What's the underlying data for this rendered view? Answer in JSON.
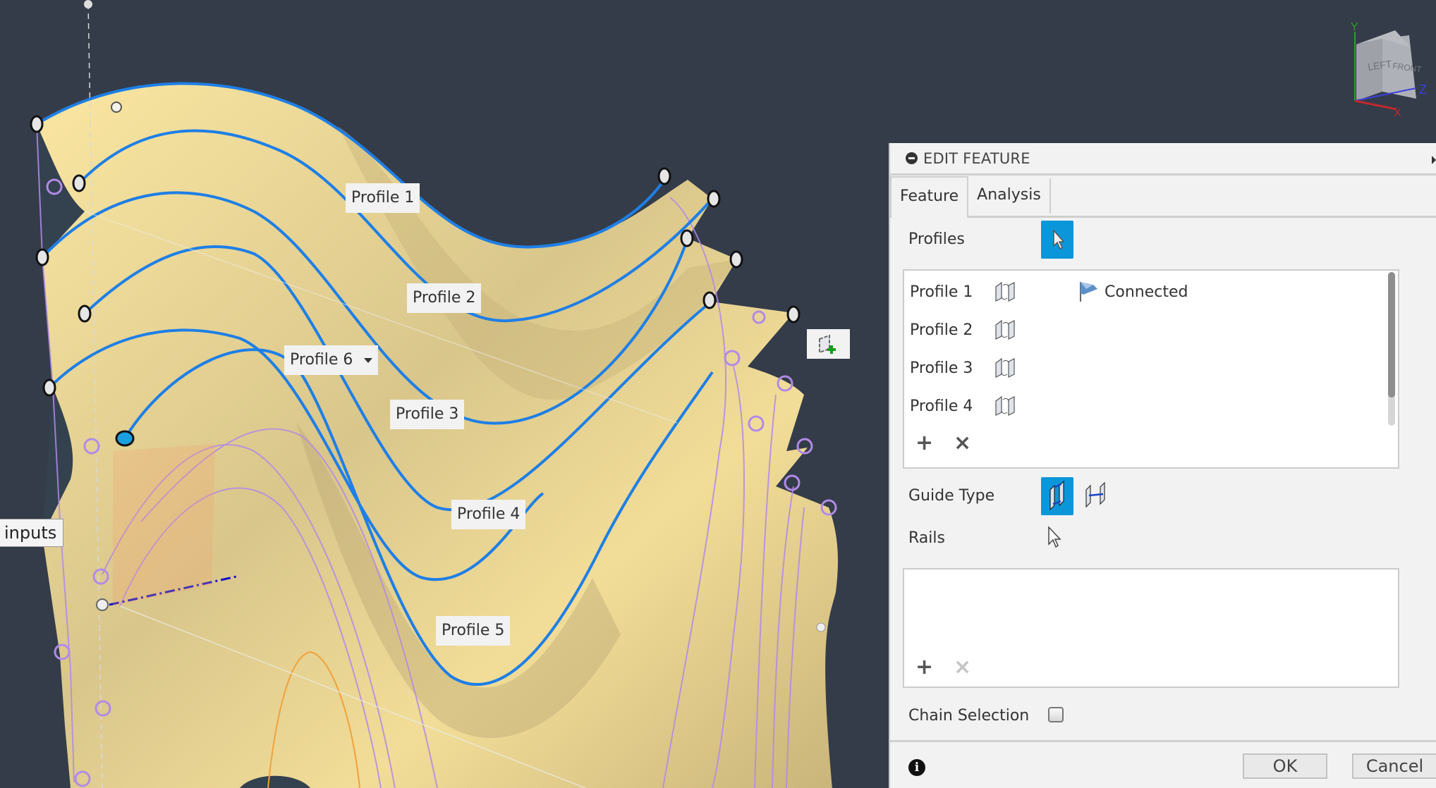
{
  "viewport": {
    "background": "#343c49",
    "surface_color": "#f5e39e",
    "profile_curve_color": "#1e7fe6",
    "rail_curve_color": "#b28ae8",
    "callouts": [
      {
        "id": "profile-1",
        "label": "Profile 1"
      },
      {
        "id": "profile-2",
        "label": "Profile 2"
      },
      {
        "id": "profile-6",
        "label": "Profile 6"
      },
      {
        "id": "profile-3",
        "label": "Profile 3"
      },
      {
        "id": "profile-4",
        "label": "Profile 4"
      },
      {
        "id": "profile-5",
        "label": "Profile 5"
      }
    ],
    "tooltip": "inputs",
    "add_plane_icon": "add-plane-icon",
    "viewcube": {
      "faces": {
        "left": "LEFT",
        "front": "FRONT"
      },
      "axes": {
        "x": "X",
        "y": "Y",
        "z": "Z"
      },
      "colors": {
        "x": "#c0282d",
        "y": "#2aa02a",
        "z": "#3c40e0"
      }
    }
  },
  "panel": {
    "title": "EDIT FEATURE",
    "tabs": [
      {
        "label": "Feature",
        "active": true
      },
      {
        "label": "Analysis",
        "active": false
      }
    ],
    "profiles": {
      "label": "Profiles",
      "select_icon": "cursor-arrow-icon",
      "items": [
        {
          "name": "Profile 1",
          "icon": "flip-direction-icon",
          "status": "Connected",
          "status_icon": "connected-flag-icon"
        },
        {
          "name": "Profile 2",
          "icon": "flip-direction-icon",
          "status": ""
        },
        {
          "name": "Profile 3",
          "icon": "flip-direction-icon",
          "status": ""
        },
        {
          "name": "Profile 4",
          "icon": "flip-direction-icon",
          "status": ""
        }
      ],
      "add_label": "+",
      "remove_label": "×"
    },
    "guide_type": {
      "label": "Guide Type",
      "options": [
        {
          "name": "rails",
          "icon": "rails-guide-icon",
          "selected": true
        },
        {
          "name": "centerline",
          "icon": "centerline-guide-icon",
          "selected": false
        }
      ]
    },
    "rails": {
      "label": "Rails",
      "items": [],
      "add_label": "+",
      "remove_label": "×"
    },
    "chain_selection": {
      "label": "Chain Selection",
      "checked": false
    },
    "accent_color": "#0b96d9",
    "footer": {
      "info_icon": "i",
      "ok_label": "OK",
      "cancel_label": "Cancel"
    }
  }
}
